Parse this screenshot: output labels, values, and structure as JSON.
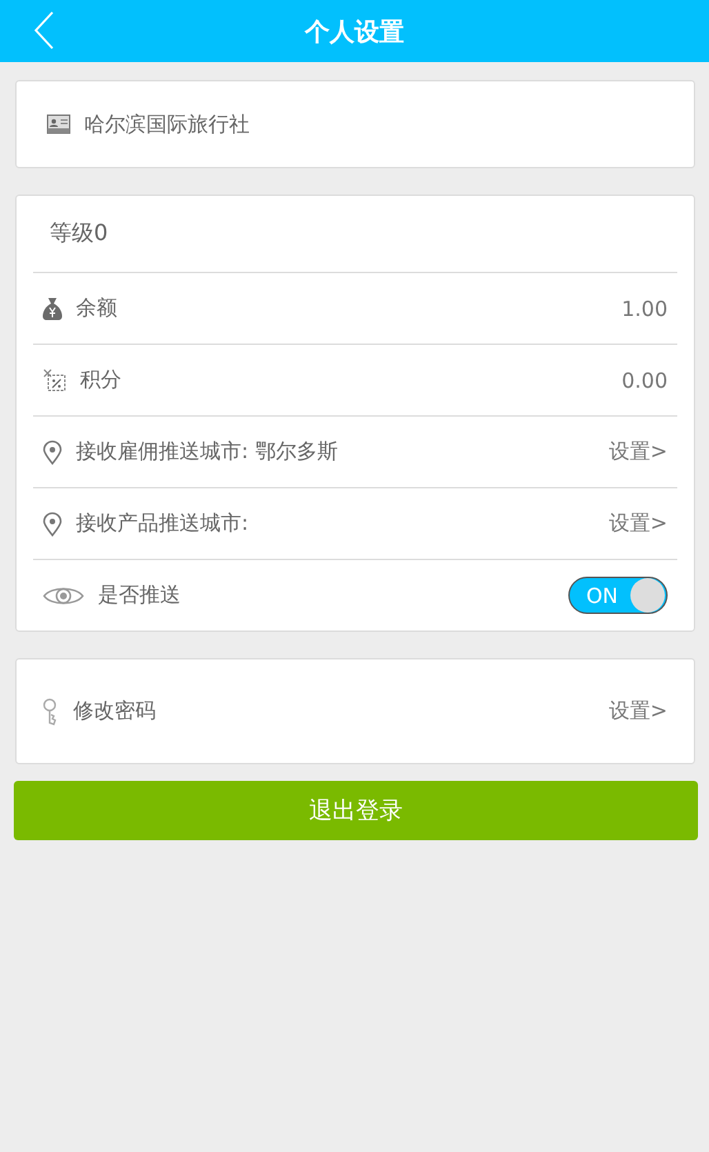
{
  "header": {
    "title": "个人设置"
  },
  "company": {
    "name": "哈尔滨国际旅行社"
  },
  "account": {
    "level": "等级0",
    "rows": [
      {
        "kind": "value",
        "label": "余额",
        "value": "1.00"
      },
      {
        "kind": "value",
        "label": "积分",
        "value": "0.00"
      },
      {
        "kind": "link",
        "label": "接收雇佣推送城市: 鄂尔多斯",
        "action": "设置>"
      },
      {
        "kind": "link",
        "label": "接收产品推送城市:",
        "action": "设置>"
      },
      {
        "kind": "toggle",
        "label": "是否推送",
        "on": true,
        "toggle_text": "ON"
      }
    ]
  },
  "security": {
    "rows": [
      {
        "kind": "link",
        "label": "修改密码",
        "action": "设置>"
      }
    ]
  },
  "logout_button": "退出登录"
}
